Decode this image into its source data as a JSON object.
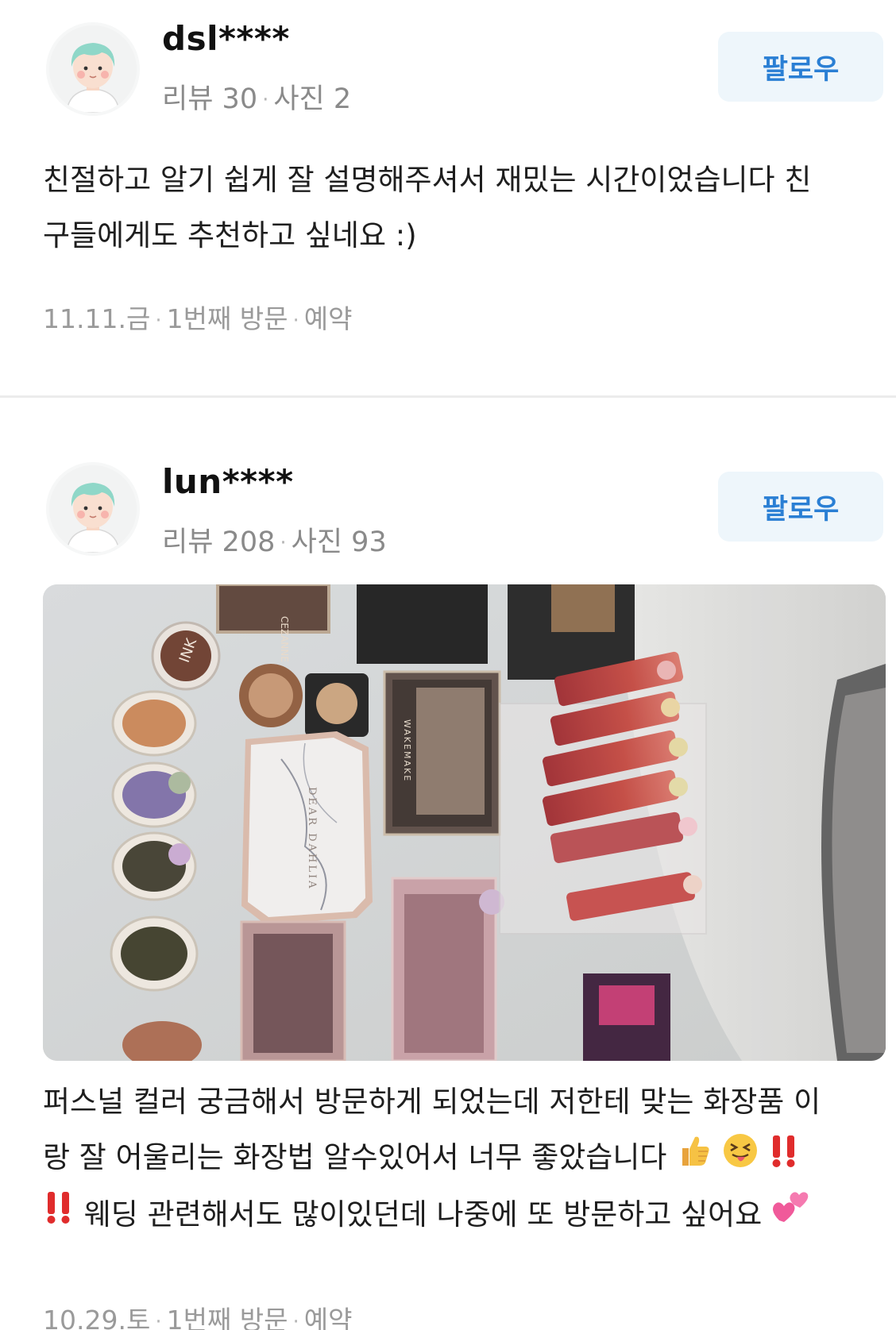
{
  "reviews": [
    {
      "user": {
        "name": "dsl****",
        "review_label": "리뷰",
        "review_count": "30",
        "photo_label": "사진",
        "photo_count": "2"
      },
      "follow_label": "팔로우",
      "text_line1": "친절하고 알기 쉽게 잘 설명해주셔서 재밌는 시간이었습니다 친",
      "text_line2": "구들에게도 추천하고 싶네요 :)",
      "visit": {
        "date": "11.11.금",
        "count": "1번째 방문",
        "type": "예약"
      }
    },
    {
      "user": {
        "name": "lun****",
        "review_label": "리뷰",
        "review_count": "208",
        "photo_label": "사진",
        "photo_count": "93"
      },
      "follow_label": "팔로우",
      "text_line1": "퍼스널 컬러 궁금해서 방문하게 되었는데 저한테 맞는 화장품 이",
      "text_line2": "랑 잘 어울리는 화장법 알수있어서 너무 좋았습니다",
      "text_line3": "웨딩 관련해서도 많이있던데 나중에 또 방문하고 싶어요",
      "photo_texts": {
        "palette1": "DEAR DAHLIA",
        "palette2": "WAKEMAKE",
        "brand": "CEZANNE",
        "pot": "INK"
      },
      "visit": {
        "date": "10.29.토",
        "count": "1번째 방문",
        "type": "예약"
      }
    }
  ],
  "icons": [
    "avatar-illustration",
    "thumbs-up-icon",
    "squinting-tongue-face-icon",
    "double-exclamation-icon",
    "two-hearts-icon"
  ],
  "colors": {
    "follow_text": "#2a7fd4",
    "follow_bg": "#eef6fb",
    "meta_gray": "#8a8a8a"
  }
}
